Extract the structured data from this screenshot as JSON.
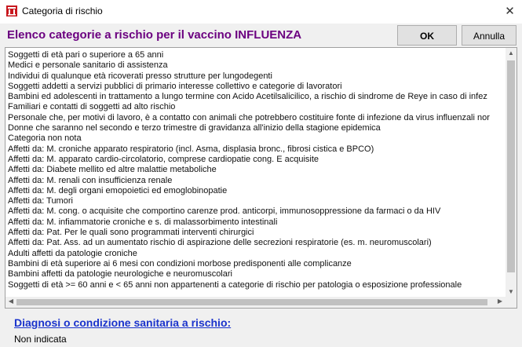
{
  "window": {
    "title": "Categoria di rischio"
  },
  "header": {
    "heading": "Elenco categorie a rischio per il vaccino INFLUENZA",
    "ok_label": "OK",
    "cancel_label": "Annulla"
  },
  "list": {
    "items": [
      "Soggetti di età pari o superiore a 65 anni",
      "Medici e personale sanitario di assistenza",
      "Individui di qualunque età ricoverati presso strutture per lungodegenti",
      "Soggetti addetti a servizi pubblici di primario interesse collettivo e categorie di lavoratori",
      "Bambini ed adolescenti in trattamento a lungo termine con Acido Acetilsalicilico, a rischio di sindrome de Reye in caso di infez",
      "Familiari e contatti di soggetti ad alto rischio",
      "Personale che, per motivi di lavoro, è a contatto con animali che potrebbero costituire fonte di infezione da virus influenzali nor",
      "Donne che saranno nel secondo e terzo trimestre di gravidanza all'inizio della stagione epidemica",
      "Categoria non nota",
      "Affetti da: M. croniche apparato respiratorio (incl. Asma, displasia bronc., fibrosi cistica e BPCO)",
      "Affetti da: M. apparato cardio-circolatorio, comprese cardiopatie cong. E acquisite",
      "Affetti da: Diabete mellito ed altre malattie metaboliche",
      "Affetti da: M. renali con insufficienza renale",
      "Affetti da: M. degli organi emopoietici ed emoglobinopatie",
      "Affetti da: Tumori",
      "Affetti da: M. cong. o acquisite che comportino carenze prod. anticorpi, immunosoppressione da farmaci o da HIV",
      "Affetti da: M. infiammatorie croniche e s. di malassorbimento intestinali",
      "Affetti da: Pat. Per le quali sono programmati interventi chirurgici",
      "Affetti da: Pat. Ass. ad un aumentato rischio di aspirazione delle secrezioni respiratorie (es. m. neuromuscolari)",
      "Adulti affetti da patologie croniche",
      "Bambini di età superiore ai 6 mesi con condizioni morbose predisponenti alle complicanze",
      "Bambini affetti da patologie neurologiche e neuromuscolari",
      "Soggetti di età >= 60 anni e < 65 anni non appartenenti a categorie di rischio per patologia o esposizione professionale"
    ]
  },
  "diagnosis": {
    "heading": "Diagnosi o condizione sanitaria a rischio:",
    "value": "Non indicata"
  },
  "icons": {
    "app": "app-icon",
    "close": "close-icon",
    "scroll_up": "chevron-up-icon",
    "scroll_down": "chevron-down-icon",
    "scroll_left": "chevron-left-icon",
    "scroll_right": "chevron-right-icon"
  },
  "colors": {
    "heading": "#6b0080",
    "link": "#1a33cc",
    "icon_red": "#c8171e"
  }
}
